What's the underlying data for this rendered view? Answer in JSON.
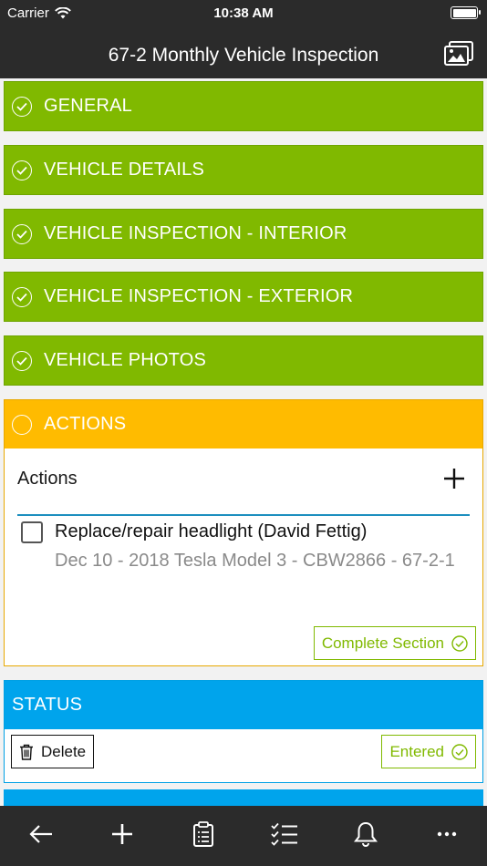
{
  "status_bar": {
    "carrier": "Carrier",
    "time": "10:38 AM"
  },
  "header": {
    "title": "67-2 Monthly Vehicle Inspection",
    "gallery_icon": "gallery-icon"
  },
  "sections": {
    "general": "GENERAL",
    "vehicle_details": "VEHICLE DETAILS",
    "vehicle_interior": "VEHICLE INSPECTION - INTERIOR",
    "vehicle_exterior": "VEHICLE INSPECTION - EXTERIOR",
    "vehicle_photos": "VEHICLE PHOTOS",
    "actions": "ACTIONS",
    "status": "STATUS"
  },
  "actions_section": {
    "list_label": "Actions",
    "item": {
      "title": "Replace/repair headlight (David Fettig)",
      "subtitle": "Dec 10 - 2018 Tesla Model 3 - CBW2866 - 67-2-1",
      "checked": false
    },
    "complete_label": "Complete Section"
  },
  "status_section": {
    "delete_label": "Delete",
    "entered_label": "Entered"
  },
  "colors": {
    "complete_green": "#80b900",
    "in_progress_orange": "#ffbb00",
    "status_blue": "#00a4ec",
    "bar_dark": "#2b2b2b"
  },
  "toolbar": {
    "icons": [
      "back-arrow-icon",
      "plus-icon",
      "clipboard-icon",
      "checklist-icon",
      "bell-icon",
      "more-icon"
    ]
  }
}
